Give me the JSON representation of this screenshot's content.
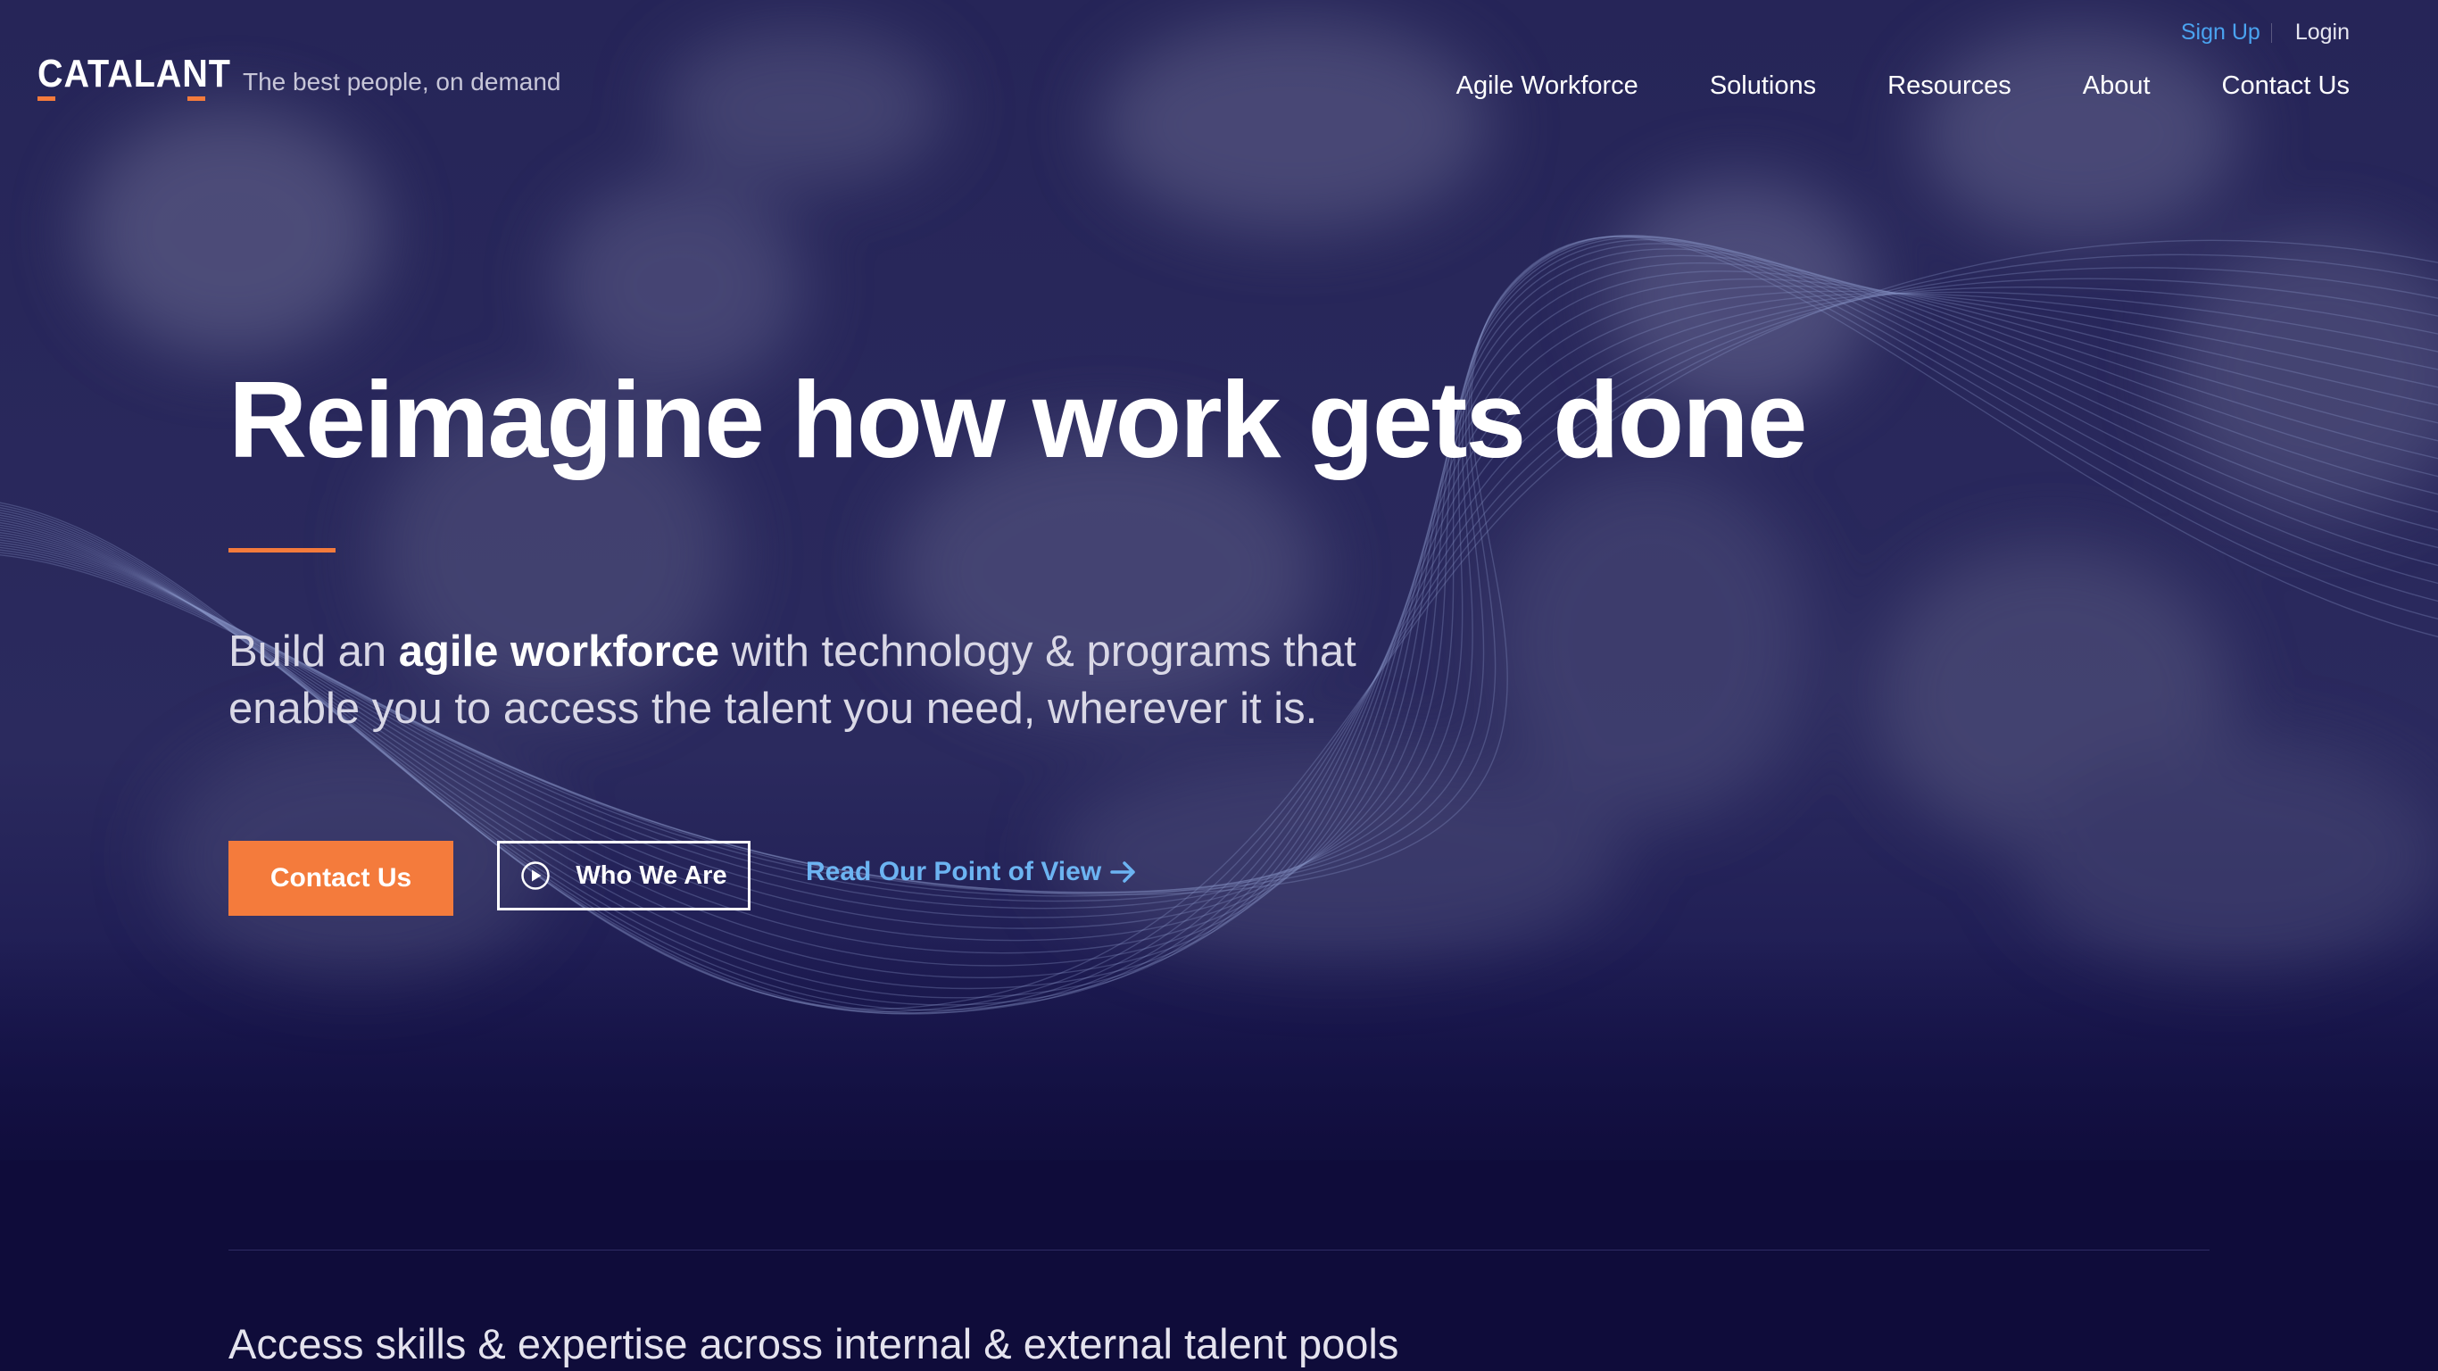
{
  "brand": {
    "logo_text": "CATALANT",
    "tagline": "The best people, on demand",
    "accent_color": "#f47b3c",
    "link_color": "#4aa3f0",
    "background_color": "#0f0c3a"
  },
  "utility_nav": {
    "sign_up": "Sign Up",
    "login": "Login"
  },
  "main_nav": {
    "items": [
      "Agile Workforce",
      "Solutions",
      "Resources",
      "About",
      "Contact Us"
    ]
  },
  "hero": {
    "headline": "Reimagine how work gets done",
    "lede_prefix": "Build an ",
    "lede_bold": "agile workforce",
    "lede_suffix": " with technology & programs that enable you to access the talent you need, wherever it is.",
    "cta_primary": "Contact Us",
    "cta_secondary": "Who We Are",
    "cta_secondary_icon": "play-circle-icon",
    "cta_link": "Read Our Point of View",
    "cta_link_icon": "arrow-right-icon"
  },
  "next_section": {
    "title": "Access skills & expertise across internal & external talent pools"
  }
}
